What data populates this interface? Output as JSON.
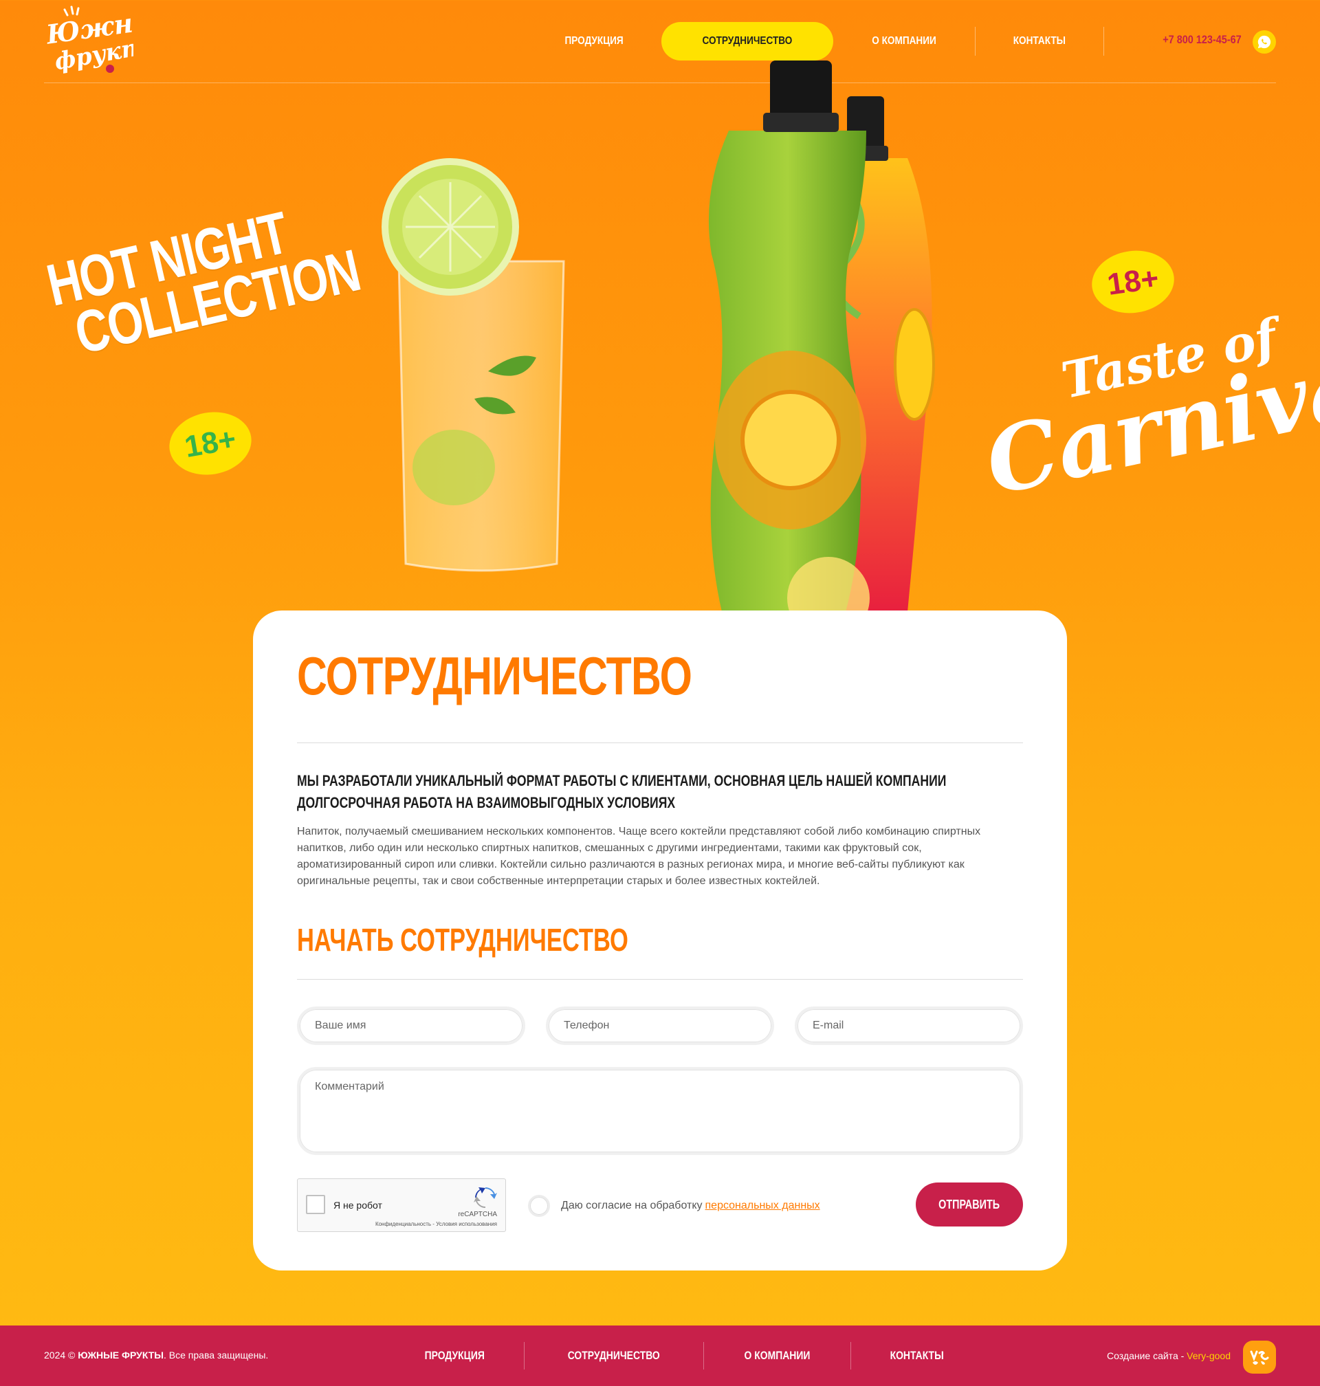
{
  "brand": {
    "logo_text_line1": "Южные",
    "logo_text_line2": "фрукты"
  },
  "nav": {
    "items": [
      {
        "label": "ПРОДУКЦИЯ",
        "active": false
      },
      {
        "label": "СОТРУДНИЧЕСТВО",
        "active": true
      },
      {
        "label": "О КОМПАНИИ",
        "active": false
      },
      {
        "label": "КОНТАКТЫ",
        "active": false
      }
    ],
    "phone": "+7 800 123-45-67",
    "phone_icon": "whatsapp-icon"
  },
  "hero": {
    "left_line1": "HOT NIGHT",
    "left_line2": "COLLECTION",
    "left_badge": "18+",
    "right_line1": "Taste of",
    "right_line2": "Carnival",
    "right_badge": "18+"
  },
  "card": {
    "title": "СОТРУДНИЧЕСТВО",
    "lead": "МЫ РАЗРАБОТАЛИ УНИКАЛЬНЫЙ ФОРМАТ РАБОТЫ С КЛИЕНТАМИ, ОСНОВНАЯ ЦЕЛЬ НАШЕЙ КОМПАНИИ ДОЛГОСРОЧНАЯ РАБОТА НА ВЗАИМОВЫГОДНЫХ УСЛОВИЯХ",
    "body": "Напиток, получаемый смешиванием нескольких компонентов. Чаще всего коктейли представляют собой либо комбинацию спиртных напитков, либо один или несколько спиртных напитков, смешанных с другими ингредиентами, такими как фруктовый сок, ароматизированный сироп или сливки. Коктейли сильно различаются в разных регионах мира, и многие веб-сайты публикуют как оригинальные рецепты, так и свои собственные интерпретации старых и более известных коктейлей.",
    "form_title": "НАЧАТЬ СОТРУДНИЧЕСТВО"
  },
  "form": {
    "name_placeholder": "Ваше имя",
    "phone_placeholder": "Телефон",
    "email_placeholder": "E-mail",
    "comment_placeholder": "Комментарий",
    "captcha_label": "Я не робот",
    "captcha_brand": "reCAPTCHA",
    "captcha_terms": "Конфиденциальность - Условия использования",
    "consent_text": "Даю согласие на обработку",
    "consent_link": "персональных данных",
    "submit_label": "ОТПРАВИТЬ"
  },
  "footer": {
    "year": "2024 ©",
    "company": "ЮЖНЫЕ ФРУКТЫ",
    "rights": ". Все права защищены.",
    "nav": [
      "ПРОДУКЦИЯ",
      "СОТРУДНИЧЕСТВО",
      "О КОМПАНИИ",
      "КОНТАКТЫ"
    ],
    "made_by_label": "Создание сайта -",
    "made_by_link": "Very-good",
    "made_by_logo": "very-good-logo"
  },
  "colors": {
    "accent_orange": "#ff7a00",
    "accent_yellow": "#ffe200",
    "accent_crimson": "#c8204a",
    "background_top": "#ff8a0a",
    "background_bottom": "#ffbb12"
  }
}
